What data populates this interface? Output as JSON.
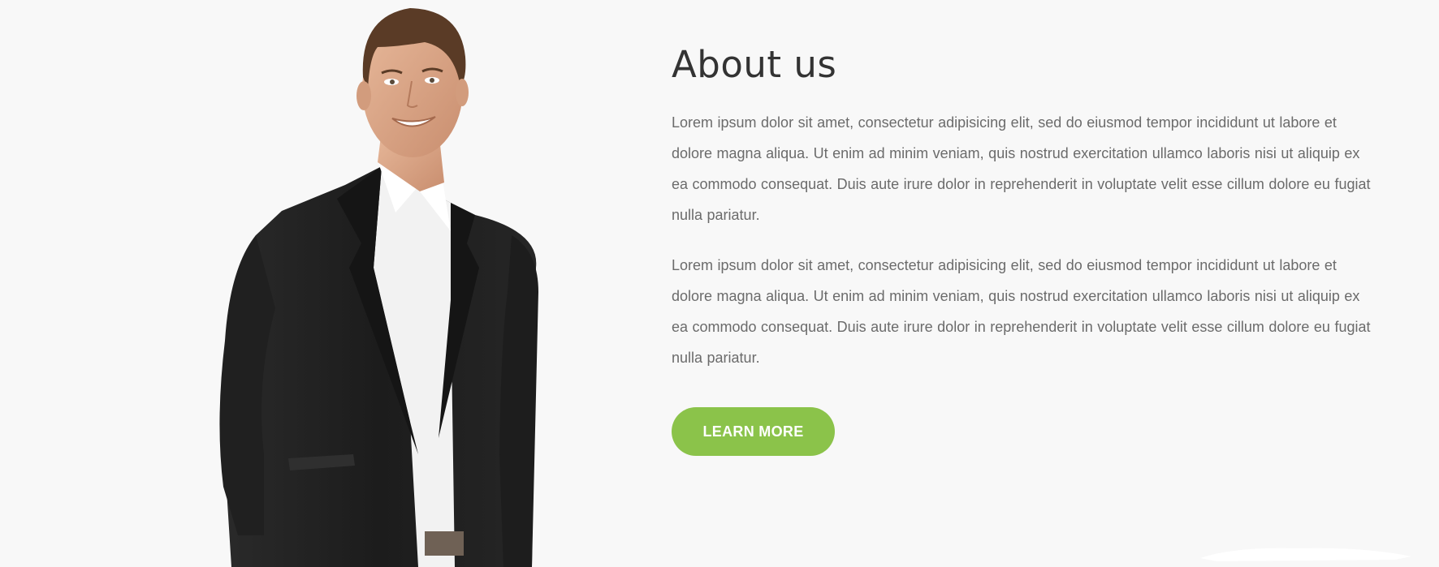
{
  "about": {
    "title": "About us",
    "paragraphs": [
      "Lorem ipsum dolor sit amet, consectetur adipisicing elit, sed do eiusmod tempor incididunt ut labore et dolore magna aliqua. Ut enim ad minim veniam, quis nostrud exercitation ullamco laboris nisi ut aliquip ex ea commodo consequat. Duis aute irure dolor in reprehenderit in voluptate velit esse cillum dolore eu fugiat nulla pariatur.",
      "Lorem ipsum dolor sit amet, consectetur adipisicing elit, sed do eiusmod tempor incididunt ut labore et dolore magna aliqua. Ut enim ad minim veniam, quis nostrud exercitation ullamco laboris nisi ut aliquip ex ea commodo consequat. Duis aute irure dolor in reprehenderit in voluptate velit esse cillum dolore eu fugiat nulla pariatur."
    ],
    "button_label": "LEARN MORE"
  },
  "colors": {
    "background": "#f8f8f8",
    "heading": "#333333",
    "body_text": "#6b6b6b",
    "accent": "#8bc34a",
    "button_text": "#ffffff"
  },
  "image": {
    "subject": "person-in-suit-photo"
  }
}
